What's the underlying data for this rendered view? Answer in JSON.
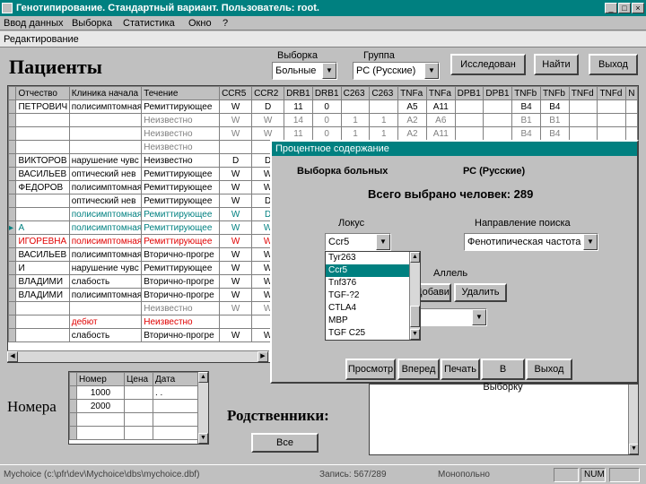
{
  "window": {
    "title": "Генотипирование. Стандартный вариант. Пользователь: root.",
    "min": "_",
    "max": "□",
    "close": "×"
  },
  "menu": [
    {
      "label": "Ввод данных"
    },
    {
      "label": "Выборка"
    },
    {
      "label": "Статистика"
    },
    {
      "label": "Окно"
    },
    {
      "label": "?"
    }
  ],
  "mode_bar": "Редактирование",
  "patients": {
    "title": "Пациенты",
    "sample_label": "Выборка",
    "sample_value": "Больные",
    "group_label": "Группа",
    "group_value": "РС (Русские)",
    "btn_research": "Исследован",
    "btn_find": "Найти",
    "btn_exit": "Выход",
    "columns": [
      "Отчество",
      "Клиника начала",
      "Течение",
      "CCR5",
      "CCR2",
      "DRB1",
      "DRB1",
      "C263",
      "C263",
      "TNFa",
      "TNFa",
      "DPB1",
      "DPB1",
      "TNFb",
      "TNFb",
      "TNFd",
      "TNFd",
      "N"
    ],
    "rows": [
      {
        "style": "",
        "marker": "",
        "cells": [
          "ПЕТРОВИЧ",
          "полисимптомная",
          "Ремиттирующее",
          "W",
          "D",
          "11",
          "0",
          "",
          "",
          "A5",
          "A11",
          "",
          "",
          "B4",
          "B4",
          "",
          "",
          ""
        ]
      },
      {
        "style": "gray",
        "marker": "",
        "cells": [
          "",
          "",
          "Неизвестно",
          "W",
          "W",
          "14",
          "0",
          "1",
          "1",
          "A2",
          "A6",
          "",
          "",
          "B1",
          "B1",
          "",
          "",
          ""
        ]
      },
      {
        "style": "gray",
        "marker": "",
        "cells": [
          "",
          "",
          "Неизвестно",
          "W",
          "W",
          "11",
          "0",
          "1",
          "1",
          "A2",
          "A11",
          "",
          "",
          "B4",
          "B4",
          "",
          "",
          ""
        ]
      },
      {
        "style": "gray",
        "marker": "",
        "cells": [
          "",
          "",
          "Неизвестно",
          "",
          "",
          "",
          "",
          "",
          "",
          "",
          "",
          "",
          "",
          "",
          "",
          "",
          "",
          ""
        ]
      },
      {
        "style": "",
        "marker": "",
        "cells": [
          "ВИКТОРОВ",
          "нарушение чувс",
          "Неизвестно",
          "D",
          "D",
          "",
          "",
          "",
          "",
          "",
          "",
          "",
          "",
          "",
          "",
          "",
          "",
          ""
        ]
      },
      {
        "style": "",
        "marker": "",
        "cells": [
          "ВАСИЛЬЕВ",
          "оптический нев",
          "Ремиттирующее",
          "W",
          "W",
          "",
          "",
          "",
          "",
          "",
          "",
          "",
          "",
          "",
          "",
          "",
          "",
          ""
        ]
      },
      {
        "style": "",
        "marker": "",
        "cells": [
          "ФЕДОРОВ",
          "полисимптомная",
          "Ремиттирующее",
          "W",
          "W",
          "",
          "",
          "",
          "",
          "",
          "",
          "",
          "",
          "",
          "",
          "",
          "",
          ""
        ]
      },
      {
        "style": "",
        "marker": "",
        "cells": [
          "",
          "оптический нев",
          "Ремиттирующее",
          "W",
          "D",
          "",
          "",
          "",
          "",
          "",
          "",
          "",
          "",
          "",
          "",
          "",
          "",
          ""
        ]
      },
      {
        "style": "green",
        "marker": "",
        "cells": [
          "",
          "полисимптомная",
          "Ремиттирующее",
          "W",
          "D",
          "",
          "",
          "",
          "",
          "",
          "",
          "",
          "",
          "",
          "",
          "",
          "",
          ""
        ]
      },
      {
        "style": "green",
        "marker": "▸",
        "cells": [
          "А",
          "полисимптомная",
          "Ремиттирующее",
          "W",
          "W",
          "",
          "",
          "",
          "",
          "",
          "",
          "",
          "",
          "",
          "",
          "",
          "",
          ""
        ]
      },
      {
        "style": "red",
        "marker": "",
        "cells": [
          "ИГОРЕВНА",
          "полисимптомная",
          "Ремиттирующее",
          "W",
          "W",
          "",
          "",
          "",
          "",
          "",
          "",
          "",
          "",
          "",
          "",
          "",
          "",
          ""
        ]
      },
      {
        "style": "",
        "marker": "",
        "cells": [
          "ВАСИЛЬЕВ",
          "полисимптомная",
          "Вторично-прогре",
          "W",
          "W",
          "",
          "",
          "",
          "",
          "",
          "",
          "",
          "",
          "",
          "",
          "",
          "",
          ""
        ]
      },
      {
        "style": "",
        "marker": "",
        "cells": [
          "И",
          "нарушение чувс",
          "Ремиттирующее",
          "W",
          "W",
          "",
          "",
          "",
          "",
          "",
          "",
          "",
          "",
          "",
          "",
          "",
          "",
          ""
        ]
      },
      {
        "style": "",
        "marker": "",
        "cells": [
          "ВЛАДИМИ",
          "слабость",
          "Вторично-прогре",
          "W",
          "W",
          "",
          "",
          "",
          "",
          "",
          "",
          "",
          "",
          "",
          "",
          "",
          "",
          ""
        ]
      },
      {
        "style": "",
        "marker": "",
        "cells": [
          "ВЛАДИМИ",
          "полисимптомная",
          "Вторично-прогре",
          "W",
          "W",
          "",
          "",
          "",
          "",
          "",
          "",
          "",
          "",
          "",
          "",
          "",
          "",
          ""
        ]
      },
      {
        "style": "gray",
        "marker": "",
        "cells": [
          "",
          "",
          "Неизвестно",
          "W",
          "W",
          "",
          "",
          "",
          "",
          "",
          "",
          "",
          "",
          "",
          "",
          "",
          "",
          ""
        ]
      },
      {
        "style": "red",
        "marker": "",
        "cells": [
          "",
          "дебют",
          "Неизвестно",
          "",
          "",
          "",
          "",
          "",
          "",
          "",
          "",
          "",
          "",
          "",
          "",
          "",
          "",
          ""
        ]
      },
      {
        "style": "",
        "marker": "",
        "cells": [
          "",
          "слабость",
          "Вторично-прогре",
          "W",
          "W",
          "",
          "",
          "",
          "",
          "",
          "",
          "",
          "",
          "",
          "",
          "",
          "",
          ""
        ]
      }
    ]
  },
  "numbers": {
    "title": "Номера",
    "columns": [
      "Номер",
      "Цена",
      "Дата"
    ],
    "rows": [
      [
        "1000",
        "",
        ". ."
      ],
      [
        "2000",
        "",
        ""
      ]
    ]
  },
  "relatives": {
    "title": "Родственники:",
    "btn_all": "Все"
  },
  "dialog": {
    "title": "Процентное содержание",
    "sample_label": "Выборка больных",
    "group_label": "РС (Русские)",
    "total_label": "Всего выбрано человек: 289",
    "locus_label": "Локус",
    "locus_value": "Ccr5",
    "direction_label": "Направление поиска",
    "direction_value": "Фенотипическая частота",
    "locus_options": [
      "Tyr263",
      "Ccr5",
      "Tnf376",
      "TGF-?2",
      "CTLA4",
      "MBP",
      "TGF C25"
    ],
    "alleles_label": "Аллель",
    "btn_add": "Добавить",
    "btn_delete": "Удалить",
    "buttons": [
      "Просмотр",
      "Вперед",
      "Печать",
      "В Выборку",
      "Выход"
    ]
  },
  "status": {
    "path": "Mychoice (c:\\pfr\\dev\\Mychoice\\dbs\\mychoice.dbf)",
    "record": "Запись: 567/289",
    "mode": "Монопольно",
    "num": "NUM"
  }
}
